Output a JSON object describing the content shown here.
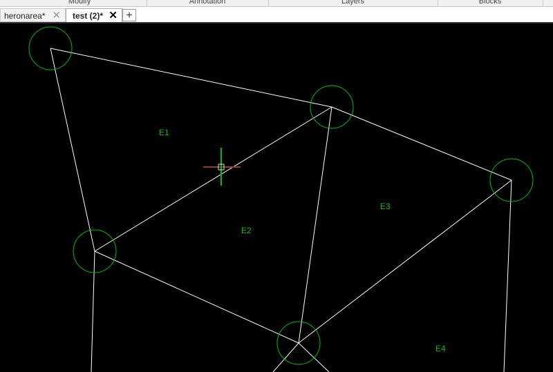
{
  "ribbon": {
    "panels": [
      "Modify",
      "Annotation",
      "Layers",
      "Blocks"
    ]
  },
  "tabs": [
    {
      "label": "heronarea*",
      "active": false
    },
    {
      "label": "test (2)*",
      "active": true
    }
  ],
  "add_tab_label": "+",
  "drawing": {
    "line_color": "#ffffff",
    "circle_color": "#00c000",
    "label_color": "#00c000",
    "labels": [
      "E1",
      "E2",
      "E3",
      "E4"
    ]
  }
}
